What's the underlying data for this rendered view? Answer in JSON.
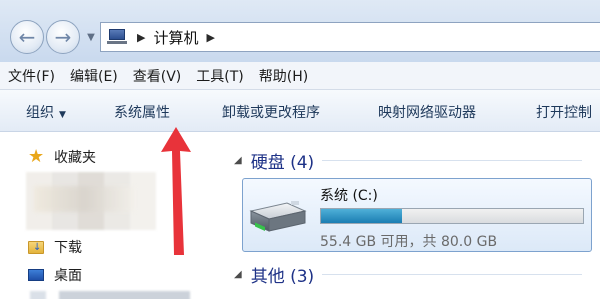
{
  "address": {
    "crumb": "计算机"
  },
  "menu": [
    "文件(F)",
    "编辑(E)",
    "查看(V)",
    "工具(T)",
    "帮助(H)"
  ],
  "commands": {
    "organize": "组织",
    "system_properties": "系统属性",
    "uninstall": "卸载或更改程序",
    "map_drive": "映射网络驱动器",
    "control_panel": "打开控制"
  },
  "nav": {
    "favorites": "收藏夹",
    "downloads": "下载",
    "desktop": "桌面"
  },
  "content": {
    "hdd_section": "硬盘 (4)",
    "other_section": "其他 (3)",
    "drive": {
      "name": "系统 (C:)",
      "info": "55.4 GB 可用，共 80.0 GB",
      "used_fraction": 0.31
    }
  },
  "colors": {
    "annotation_arrow": "#e8333a",
    "section_title": "#1e3287",
    "drive_bar": "#1b7db2"
  }
}
